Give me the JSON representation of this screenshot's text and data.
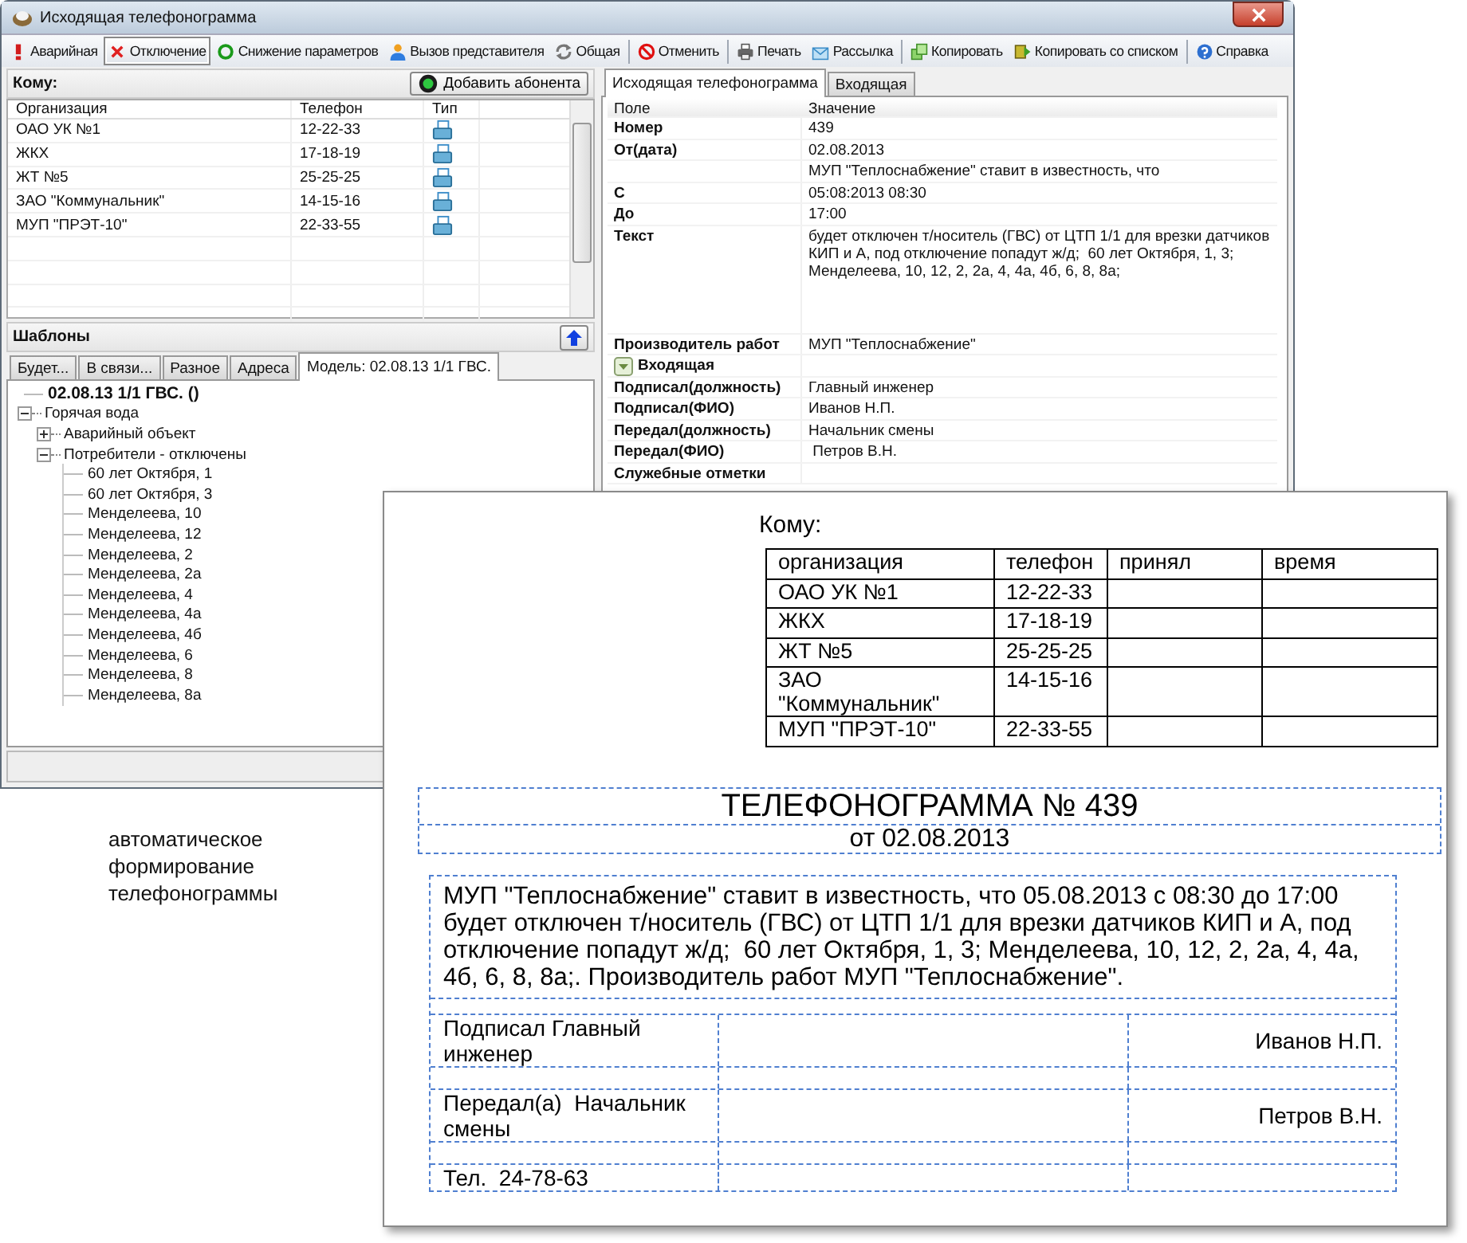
{
  "window": {
    "title": "Исходящая телефонограмма"
  },
  "toolbar": [
    [
      {
        "label": "Аварийная",
        "selected": false
      },
      {
        "label": "Отключение",
        "selected": true
      },
      {
        "label": "Снижение параметров",
        "selected": false
      },
      {
        "label": "Вызов представителя",
        "selected": false
      },
      {
        "label": "Общая",
        "selected": false
      }
    ],
    [
      {
        "label": "Отменить",
        "selected": false
      }
    ],
    [
      {
        "label": "Печать",
        "selected": false
      },
      {
        "label": "Рассылка",
        "selected": false
      }
    ],
    [
      {
        "label": "Копировать",
        "selected": false
      },
      {
        "label": "Копировать со списком",
        "selected": false
      }
    ],
    [
      {
        "label": "Справка",
        "selected": false
      }
    ]
  ],
  "recipients": {
    "title": "Кому:",
    "add_button": "Добавить абонента",
    "columns": [
      "Организация",
      "Телефон",
      "Тип"
    ],
    "rows": [
      {
        "org": "ОАО УК №1",
        "phone": "12-22-33"
      },
      {
        "org": "ЖКХ",
        "phone": "17-18-19"
      },
      {
        "org": "ЖТ №5",
        "phone": "25-25-25"
      },
      {
        "org": "ЗАО \"Коммунальник\"",
        "phone": "14-15-16"
      },
      {
        "org": "МУП \"ПРЭТ-10\"",
        "phone": "22-33-55"
      }
    ]
  },
  "templates": {
    "title": "Шаблоны",
    "tabs": [
      {
        "label": "Будет...",
        "selected": false
      },
      {
        "label": "В связи...",
        "selected": false
      },
      {
        "label": "Разное",
        "selected": false
      },
      {
        "label": "Адреса",
        "selected": false
      },
      {
        "label": "Модель: 02.08.13 1/1 ГВС.",
        "selected": true
      }
    ],
    "tree": [
      {
        "label": "02.08.13 1/1 ГВС. ()",
        "kind": "title"
      },
      {
        "label": "Горячая вода",
        "kind": "node",
        "expanded": true,
        "children": [
          {
            "label": "Аварийный объект",
            "kind": "node",
            "expanded": false
          },
          {
            "label": "Потребители - отключены",
            "kind": "node",
            "expanded": true,
            "children": [
              {
                "label": "60 лет Октября, 1",
                "kind": "leaf"
              },
              {
                "label": "60 лет Октября, 3",
                "kind": "leaf"
              },
              {
                "label": "Менделеева, 10",
                "kind": "leaf"
              },
              {
                "label": "Менделеева, 12",
                "kind": "leaf"
              },
              {
                "label": "Менделеева, 2",
                "kind": "leaf"
              },
              {
                "label": "Менделеева, 2а",
                "kind": "leaf"
              },
              {
                "label": "Менделеева, 4",
                "kind": "leaf"
              },
              {
                "label": "Менделеева, 4а",
                "kind": "leaf"
              },
              {
                "label": "Менделеева, 4б",
                "kind": "leaf"
              },
              {
                "label": "Менделеева, 6",
                "kind": "leaf"
              },
              {
                "label": "Менделеева, 8",
                "kind": "leaf"
              },
              {
                "label": "Менделеева, 8а",
                "kind": "leaf"
              }
            ]
          }
        ]
      }
    ]
  },
  "details": {
    "tabs": [
      {
        "label": "Исходящая телефонограмма",
        "selected": true
      },
      {
        "label": "Входящая",
        "selected": false
      }
    ],
    "columns": [
      "Поле",
      "Значение"
    ],
    "rows": [
      {
        "kind": "field",
        "field": "Номер",
        "value": "439"
      },
      {
        "kind": "field",
        "field": "От(дата)",
        "value": "02.08.2013"
      },
      {
        "kind": "field",
        "value": "МУП \"Теплоснабжение\" ставит в известность, что"
      },
      {
        "kind": "field",
        "field": "С",
        "value": "05:08:2013 08:30"
      },
      {
        "kind": "field",
        "field": "До",
        "value": "17:00"
      },
      {
        "kind": "text",
        "field": "Текст",
        "value": "будет отключен т/носитель (ГВС) от ЦТП 1/1 для врезки датчиков КИП и А, под отключение попадут ж/д;  60 лет Октября, 1, 3; Менделеева, 10, 12, 2, 2а, 4, 4а, 4б, 6, 8, 8а;"
      },
      {
        "kind": "field",
        "field": "Производитель работ",
        "value": "МУП \"Теплоснабжение\""
      },
      {
        "kind": "group",
        "field": "Входящая",
        "expanded": true
      },
      {
        "kind": "field",
        "field": "Подписал(должность)",
        "value": "Главный инженер"
      },
      {
        "kind": "field",
        "field": "Подписал(ФИО)",
        "value": "Иванов Н.П."
      },
      {
        "kind": "field",
        "field": "Передал(должность)",
        "value": "Начальник смены"
      },
      {
        "kind": "field",
        "field": "Передал(ФИО)",
        "value": " Петров В.Н."
      },
      {
        "kind": "field",
        "field": "Служебные отметки"
      }
    ]
  },
  "document": {
    "to_label": "Кому:",
    "columns": [
      "организация",
      "телефон",
      "принял",
      "время"
    ],
    "rows": [
      {
        "org": "ОАО УК №1",
        "phone": "12-22-33"
      },
      {
        "org": "ЖКХ",
        "phone": "17-18-19"
      },
      {
        "org": "ЖТ №5",
        "phone": "25-25-25"
      },
      {
        "org": "ЗАО \"Коммунальник\"",
        "phone": "14-15-16"
      },
      {
        "org": "МУП \"ПРЭТ-10\"",
        "phone": "22-33-55"
      }
    ],
    "title": "ТЕЛЕФОНОГРАММА № 439",
    "date": "от 02.08.2013",
    "body": "МУП \"Теплоснабжение\" ставит в известность, что 05.08.2013 с 08:30 до 17:00 будет отключен т/носитель (ГВС) от ЦТП 1/1 для врезки датчиков КИП и А, под отключение попадут ж/д;  60 лет Октября, 1, 3; Менделеева, 10, 12, 2, 2а, 4, 4а, 4б, 6, 8, 8а;. Производитель работ МУП \"Теплоснабжение\".",
    "signatures": [
      {
        "label": "Подписал Главный инженер",
        "name": "Иванов Н.П."
      },
      {
        "label": "Передал(а)  Начальник смены",
        "name": "Петров В.Н."
      }
    ],
    "phone": "Тел.  24-78-63"
  },
  "caption": "автоматическое формирование телефонограммы"
}
